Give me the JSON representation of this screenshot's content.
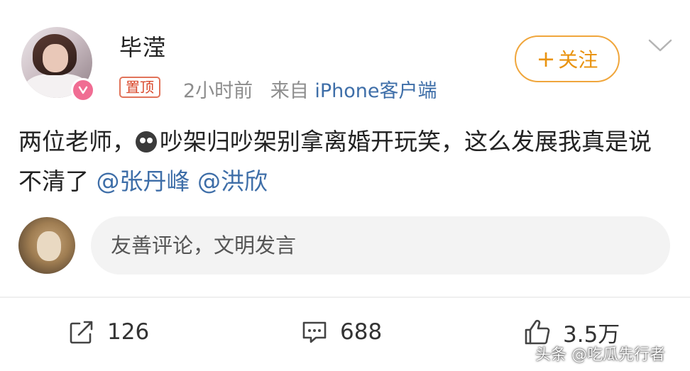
{
  "post": {
    "author": {
      "name": "毕滢",
      "avatar_icon": "user-avatar",
      "verified_badge_icon": "verified-v-icon"
    },
    "pinned_label": "置顶",
    "time": "2小时前",
    "source_prefix": "来自",
    "source_client": "iPhone客户端",
    "follow_label": "关注",
    "content_before_emoji": "两位老师，",
    "content_emoji": "sad-face-emoji",
    "content_after_emoji": "吵架归吵架别拿离婚开玩笑，这么发展我真是说不清了 ",
    "mentions": [
      "@张丹峰",
      "@洪欣"
    ]
  },
  "comment_box": {
    "placeholder": "友善评论，文明发言"
  },
  "actions": {
    "repost_count": "126",
    "comment_count": "688",
    "like_count": "3.5万"
  },
  "watermark": "头条 @吃瓜先行者",
  "colors": {
    "follow_orange": "#e9930f",
    "link_blue": "#3e6ea8",
    "pin_red": "#d9482b",
    "badge_pink": "#f06d93"
  }
}
